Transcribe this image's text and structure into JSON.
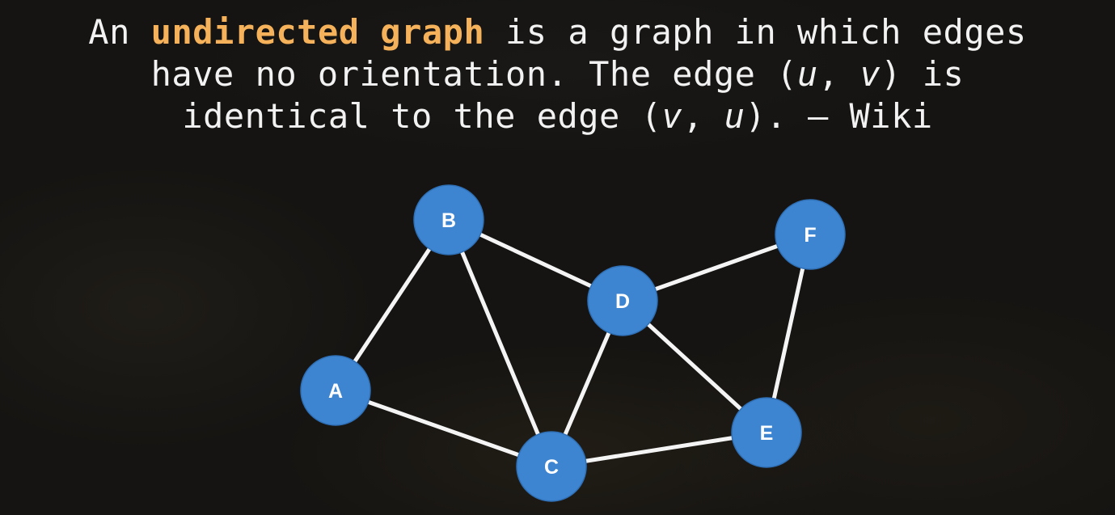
{
  "quote": {
    "line1_before": "An ",
    "line1_highlight": "undirected graph",
    "line1_after": " is a graph in which edges",
    "line2": "have no orientation. The edge (",
    "line2_u": "u",
    "line2_sep": ", ",
    "line2_v": "v",
    "line2_end": ") is",
    "line3_before": "identical to the edge (",
    "line3_v": "v",
    "line3_sep": ", ",
    "line3_u": "u",
    "line3_end": "). – Wiki"
  },
  "colors": {
    "highlight": "#f6b25a",
    "node_fill": "#3d85d1",
    "edge": "#f4f4f4",
    "text": "#f2f2f2"
  },
  "graph": {
    "type": "undirected",
    "nodes": [
      "A",
      "B",
      "C",
      "D",
      "E",
      "F"
    ],
    "edges": [
      [
        "A",
        "B"
      ],
      [
        "A",
        "C"
      ],
      [
        "B",
        "C"
      ],
      [
        "B",
        "D"
      ],
      [
        "C",
        "D"
      ],
      [
        "C",
        "E"
      ],
      [
        "D",
        "E"
      ],
      [
        "D",
        "F"
      ],
      [
        "E",
        "F"
      ]
    ]
  }
}
